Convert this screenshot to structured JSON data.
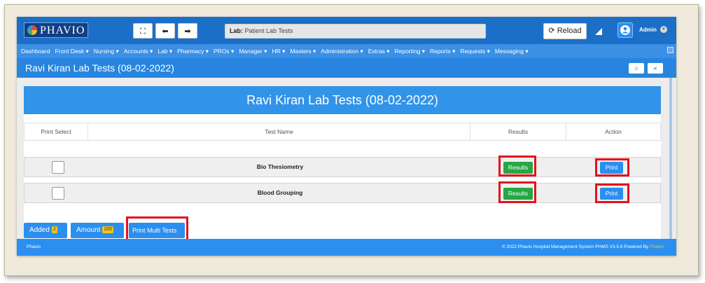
{
  "app": {
    "logo_text": "PHAVIO"
  },
  "toolbar": {
    "expand_glyph": "⛶",
    "back_glyph": "⬅",
    "forward_glyph": "➡",
    "reload_label": "Reload"
  },
  "location": {
    "prefix": "Lab:",
    "value": "Patient Lab Tests"
  },
  "user": {
    "name": "Admin"
  },
  "nav": {
    "items": [
      "Dashboard",
      "Front Desk ▾",
      "Nursing ▾",
      "Accounts ▾",
      "Lab ▾",
      "Pharmacy ▾",
      "PROs ▾",
      "Manager ▾",
      "HR ▾",
      "Masters ▾",
      "Administration ▾",
      "Extras ▾",
      "Reporting ▾",
      "Reports ▾",
      "Requests ▾",
      "Messaging ▾"
    ]
  },
  "page": {
    "title": "Ravi Kiran Lab Tests (08-02-2022)",
    "heading": "Ravi Kiran Lab Tests (08-02-2022)"
  },
  "table": {
    "headers": [
      "Print Select",
      "Test Name",
      "Results",
      "Action"
    ],
    "rows": [
      {
        "test_name": "Bio Thesiometry",
        "results_label": "Results",
        "action_label": "Print"
      },
      {
        "test_name": "Blood Grouping",
        "results_label": "Results",
        "action_label": "Print"
      }
    ]
  },
  "summary": {
    "added_label": "Added",
    "added_count": "2",
    "amount_label": "Amount",
    "amount_value": "200",
    "print_multi_label": "Print Multi Tests"
  },
  "footer": {
    "left": "Phavio",
    "right": "© 2022 Phavio Hospital Management System PHMS V3.5.6 Powered By",
    "brand": "Phavio"
  },
  "colors": {
    "primary": "#2b8ff0",
    "success": "#27a744",
    "highlight": "#e3131b",
    "topbar": "#1c6fc6"
  }
}
